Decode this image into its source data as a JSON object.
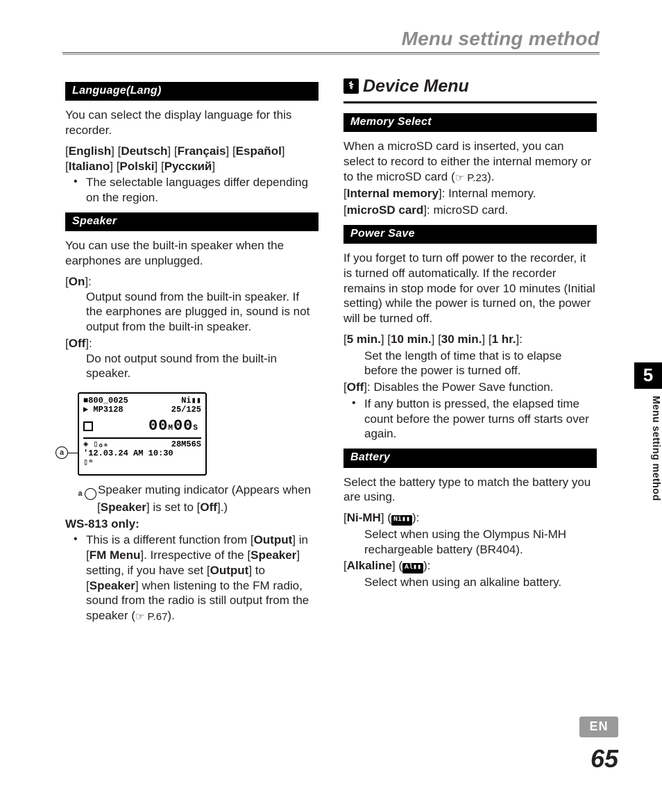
{
  "page_title": "Menu setting method",
  "chapter_number": "5",
  "side_label": "Menu setting method",
  "lang_badge": "EN",
  "page_number": "65",
  "left": {
    "language": {
      "bar": "Language(Lang)",
      "intro": "You can select the display language for this recorder.",
      "opts": {
        "english": "English",
        "deutsch": "Deutsch",
        "francais": "Français",
        "espanol": "Español",
        "italiano": "Italiano",
        "polski": "Polski",
        "russkiy": "Русский"
      },
      "note": "The selectable languages differ depending on the region."
    },
    "speaker": {
      "bar": "Speaker",
      "intro": "You can use the built-in speaker when the earphones are unplugged.",
      "on_label": "On",
      "on_desc": "Output sound from the built-in speaker. If the earphones are plugged in, sound is not output from the built-in speaker.",
      "off_label": "Off",
      "off_desc": "Do not output sound from the built-in speaker.",
      "lcd": {
        "row1_left": "■800_0025",
        "row1_right": "Ni▮▮",
        "row2_left": "▶ MP3128",
        "row2_right": "25/125",
        "big_m": "00",
        "big_s": "00",
        "unit_m": "M",
        "unit_s": "S",
        "row4_left": "◈ ▯ₒₙ",
        "row4_right": "28M56S",
        "row5": "'12.03.24 AM 10:30",
        "row6": "▯ⁿ"
      },
      "callout_letter": "a",
      "callout_text_pre": "Speaker muting indicator (Appears when [",
      "callout_bold": "Speaker",
      "callout_text_mid": "] is set to [",
      "callout_bold2": "Off",
      "callout_text_post": "].)",
      "ws813_label": "WS-813 only:",
      "ws813_text_1": "This is a different function from [",
      "ws813_b1": "Output",
      "ws813_text_2": "] in [",
      "ws813_b2": "FM Menu",
      "ws813_text_3": "]. Irrespective of the [",
      "ws813_b3": "Speaker",
      "ws813_text_4": "] setting, if you have set [",
      "ws813_b4": "Output",
      "ws813_text_5": "] to [",
      "ws813_b5": "Speaker",
      "ws813_text_6": "] when listening to the FM radio, sound from the radio is still output from the speaker (",
      "ws813_ref": "☞ P.67",
      "ws813_text_7": ")."
    }
  },
  "right": {
    "heading": "Device Menu",
    "memory": {
      "bar": "Memory Select",
      "intro_1": "When a microSD card is inserted, you can select to record to either the internal memory or to the microSD card (",
      "intro_ref": "☞ P.23",
      "intro_2": ").",
      "internal_label": "Internal memory",
      "internal_desc": ": Internal memory.",
      "sd_label": "microSD card",
      "sd_desc": ": microSD card."
    },
    "power": {
      "bar": "Power Save",
      "intro": "If you forget to turn off power to the recorder, it is turned off automatically. If the recorder remains in stop mode for over 10 minutes (Initial setting) while the power is turned on, the power will be turned off.",
      "o5": "5 min.",
      "o10": "10 min.",
      "o30": "30 min.",
      "o1h": "1 hr.",
      "times_desc": "Set the length of time that is to elapse before the power is turned off.",
      "off_label": "Off",
      "off_desc": ": Disables the Power Save function.",
      "note": "If any button is pressed, the elapsed time count before the power turns off starts over again."
    },
    "battery": {
      "bar": "Battery",
      "intro": "Select the battery type to match the battery you are using.",
      "nimh_label": "Ni-MH",
      "nimh_icon": "Ni▮▮",
      "nimh_desc": "Select when using the Olympus Ni-MH rechargeable battery (BR404).",
      "alk_label": "Alkaline",
      "alk_icon": "Al▮▮",
      "alk_desc": "Select when using an alkaline battery."
    }
  }
}
